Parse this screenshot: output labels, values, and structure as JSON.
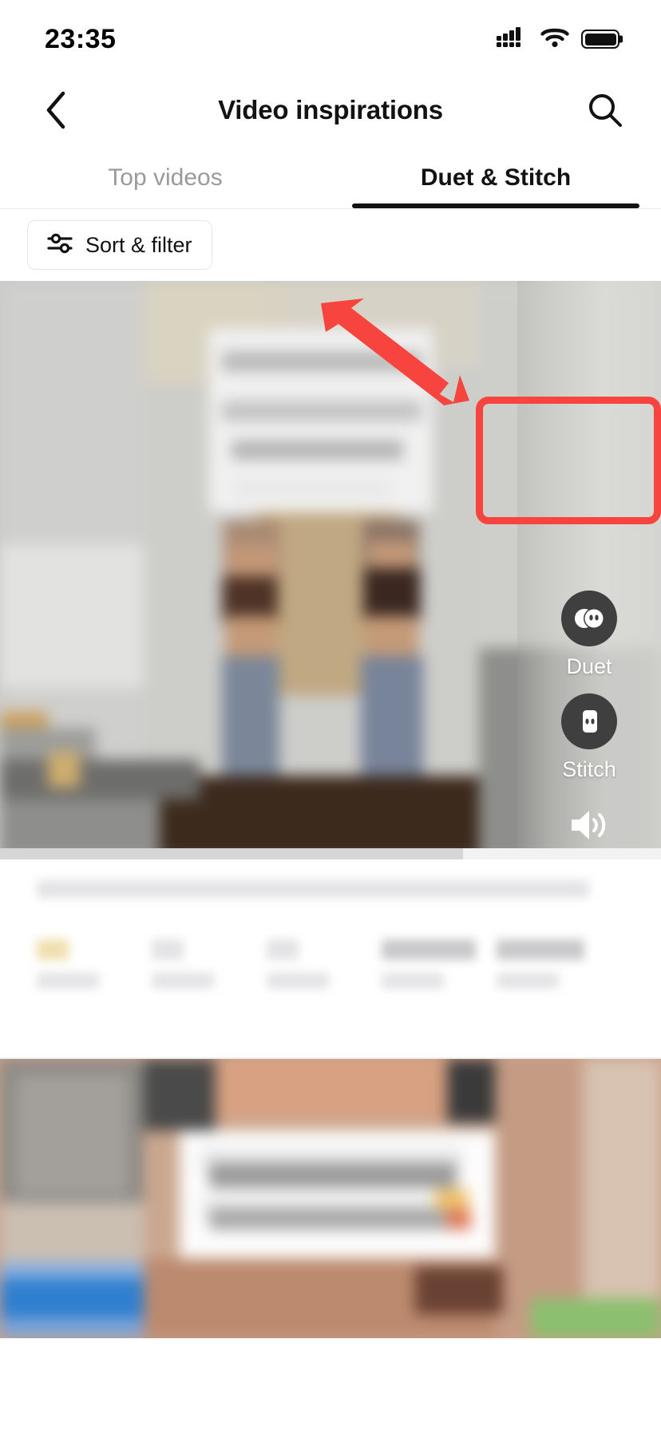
{
  "status_bar": {
    "time": "23:35",
    "signal_icon": "cellular-signal-icon",
    "wifi_icon": "wifi-icon",
    "battery_icon": "battery-full-icon"
  },
  "nav": {
    "back_icon": "chevron-left-icon",
    "title": "Video inspirations",
    "search_icon": "search-icon"
  },
  "tabs": [
    {
      "label": "Top videos",
      "active": false
    },
    {
      "label": "Duet & Stitch",
      "active": true
    }
  ],
  "filter": {
    "sort_filter_label": "Sort & filter",
    "sort_filter_icon": "sliders-filter-icon"
  },
  "video_card": {
    "actions": [
      {
        "label": "Duet",
        "icon": "duet-icon",
        "highlighted": false
      },
      {
        "label": "Stitch",
        "icon": "stitch-icon",
        "highlighted": true
      }
    ],
    "sound_icon": "speaker-volume-icon",
    "progress_percent": 70
  },
  "annotations": {
    "arrow_color": "#f8443e",
    "highlight_color": "#f8443e",
    "arrow_name": "red-pointer-arrow",
    "highlight_target": "Stitch"
  },
  "colors": {
    "accent_red": "#f8443e",
    "text_primary": "#121212",
    "text_muted": "#9a9a9e",
    "border": "#e6e6e8",
    "rail_icon_bg": "#3f3f3f"
  }
}
